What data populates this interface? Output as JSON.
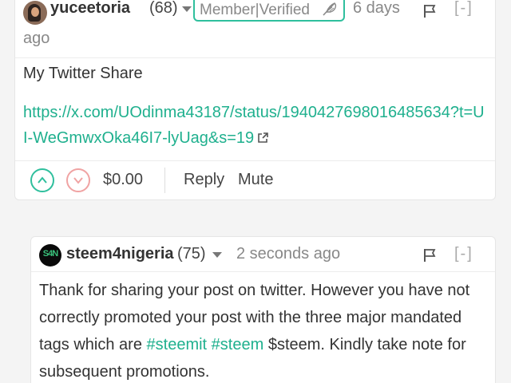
{
  "comment": {
    "author": "yuceetoria",
    "reputation": "(68)",
    "badge": "Member|Verified",
    "time_line1": "6 days",
    "time_line2": "ago",
    "collapse": "[-]",
    "title": "My Twitter Share",
    "link": "https://x.com/UOdinma43187/status/1940427698016485634?t=UI-WeGmwxOka46I7-lyUag&s=19",
    "payout": "$0.00",
    "reply_label": "Reply",
    "mute_label": "Mute"
  },
  "reply": {
    "author": "steem4nigeria",
    "logo_text": "S4N",
    "reputation": "(75)",
    "time": "2 seconds ago",
    "collapse": "[-]",
    "body_part1": "Thank for sharing your post on twitter. However you have not correctly promoted your post with the three major mandated tags which are ",
    "tag1": "#steemit",
    "tag2": "#steem",
    "body_part2": " $steem. Kindly take note for subsequent promotions."
  },
  "colors": {
    "accent": "#1fb08e",
    "downvote": "#f0a3a3",
    "muted_text": "#888888"
  },
  "icons": [
    "chevron-down-icon",
    "feather-icon",
    "flag-icon",
    "external-link-icon",
    "upvote-icon",
    "downvote-icon"
  ]
}
